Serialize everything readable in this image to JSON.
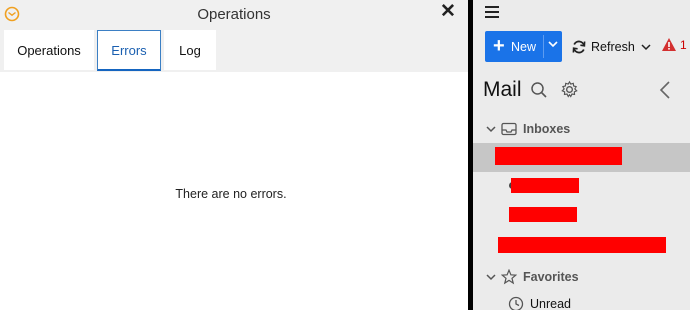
{
  "operations_dialog": {
    "title": "Operations",
    "tabs": [
      {
        "label": "Operations",
        "active": false
      },
      {
        "label": "Errors",
        "active": true
      },
      {
        "label": "Log",
        "active": false
      }
    ],
    "empty_message": "There are no errors."
  },
  "mail": {
    "toolbar": {
      "new_label": "New",
      "refresh_label": "Refresh",
      "alert_count": "1"
    },
    "header": "Mail",
    "sections": {
      "inboxes": "Inboxes",
      "favorites": "Favorites"
    },
    "favorites_items": [
      {
        "label": "Unread",
        "icon": "clock-icon"
      }
    ]
  },
  "colors": {
    "accent": "#1a73e8",
    "active_tab": "#1565c0",
    "redaction": "#ff0000",
    "alert": "#cc0000"
  }
}
